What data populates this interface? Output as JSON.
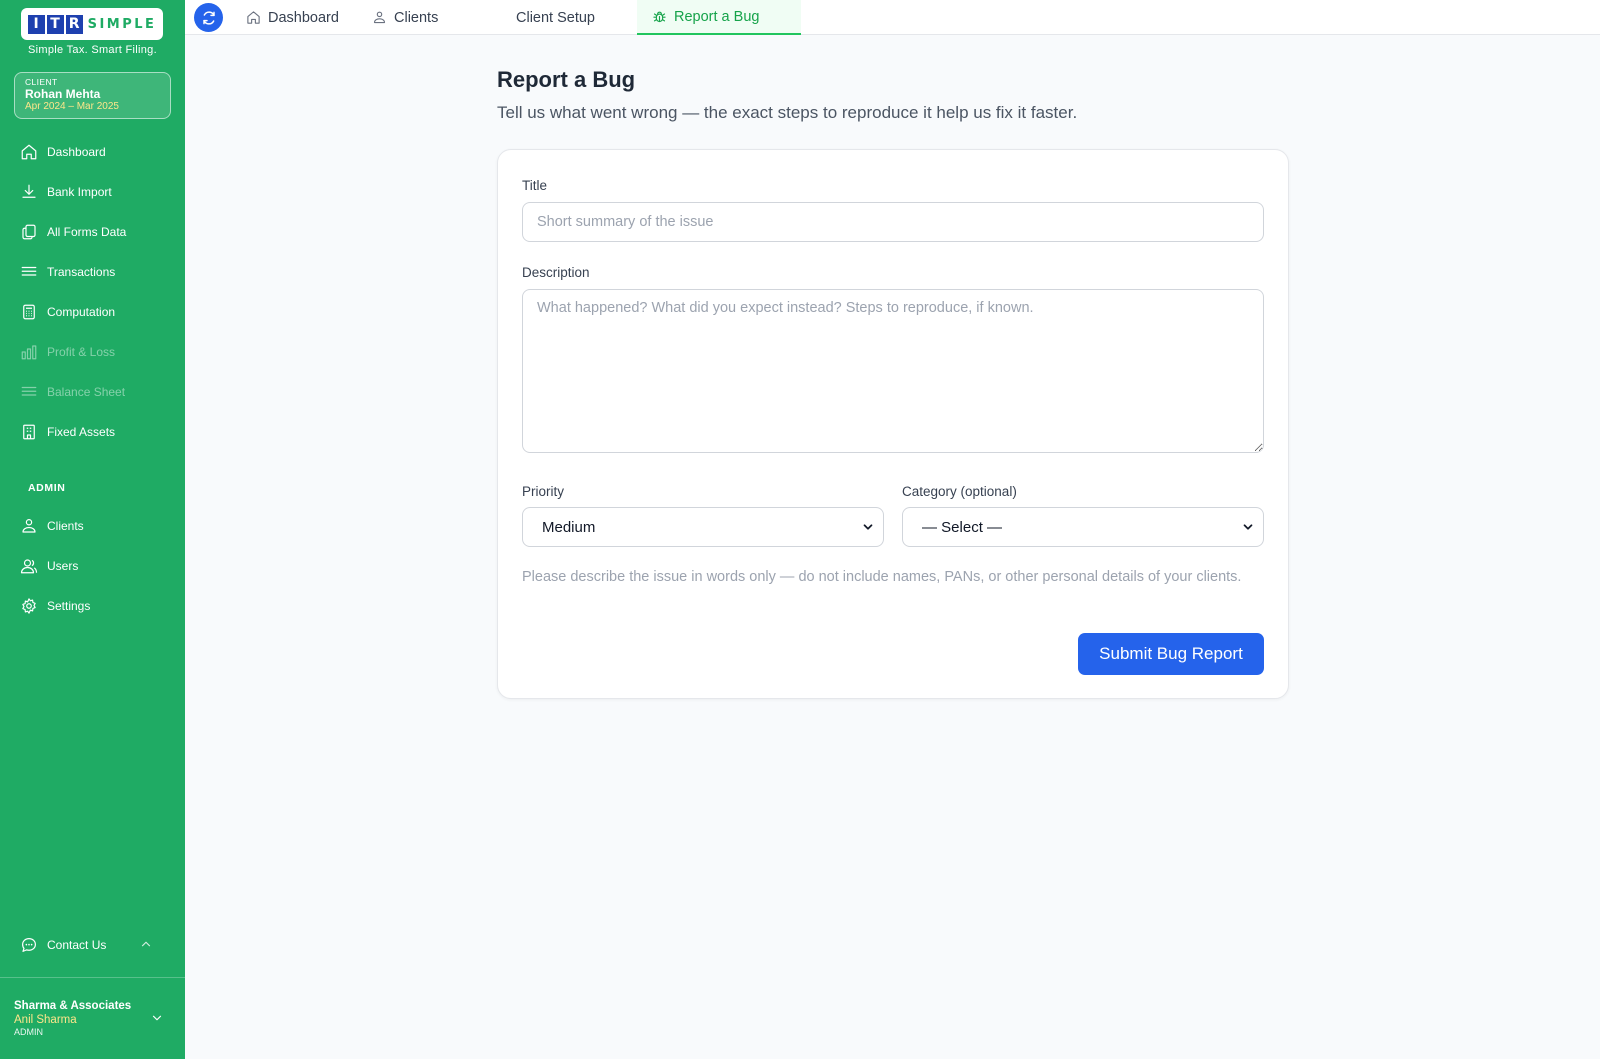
{
  "brand": {
    "logo_letters": [
      "I",
      "T",
      "R"
    ],
    "logo_rest": "SIMPLE",
    "tagline": "Simple Tax. Smart Filing.",
    "colors": {
      "sidebar": "#1fab64",
      "primary_button": "#2563eb",
      "active_tab": "#16a34a",
      "logo_blue": "#1e40af"
    }
  },
  "client_card": {
    "label": "CLIENT",
    "name": "Rohan Mehta",
    "period": "Apr 2024 – Mar 2025"
  },
  "sidebar": {
    "items": [
      {
        "label": "Dashboard",
        "icon": "home-icon",
        "enabled": true
      },
      {
        "label": "Bank Import",
        "icon": "download-icon",
        "enabled": true
      },
      {
        "label": "All Forms Data",
        "icon": "documents-icon",
        "enabled": true
      },
      {
        "label": "Transactions",
        "icon": "list-icon",
        "enabled": true
      },
      {
        "label": "Computation",
        "icon": "calculator-icon",
        "enabled": true
      },
      {
        "label": "Profit & Loss",
        "icon": "bar-chart-icon",
        "enabled": false
      },
      {
        "label": "Balance Sheet",
        "icon": "list-icon",
        "enabled": false
      },
      {
        "label": "Fixed Assets",
        "icon": "building-icon",
        "enabled": true
      }
    ],
    "admin_label": "ADMIN",
    "admin_items": [
      {
        "label": "Clients",
        "icon": "clients-icon"
      },
      {
        "label": "Users",
        "icon": "users-icon"
      },
      {
        "label": "Settings",
        "icon": "gear-icon"
      }
    ],
    "contact_label": "Contact Us",
    "firm": {
      "name": "Sharma & Associates",
      "user": "Anil Sharma",
      "role": "ADMIN"
    }
  },
  "topbar": {
    "tabs": [
      {
        "label": "Dashboard",
        "icon": "home-icon",
        "active": false
      },
      {
        "label": "Clients",
        "icon": "clients-icon",
        "active": false
      },
      {
        "label": "Client Setup",
        "icon": "",
        "active": false
      },
      {
        "label": "Report a Bug",
        "icon": "bug-icon",
        "active": true
      }
    ]
  },
  "page": {
    "title": "Report a Bug",
    "subtitle": "Tell us what went wrong — the exact steps to reproduce it help us fix it faster."
  },
  "form": {
    "title_label": "Title",
    "title_placeholder": "Short summary of the issue",
    "title_value": "",
    "description_label": "Description",
    "description_placeholder": "What happened? What did you expect instead? Steps to reproduce, if known.",
    "description_value": "",
    "priority_label": "Priority",
    "priority_value": "Medium",
    "category_label": "Category (optional)",
    "category_value": "— Select —",
    "note": "Please describe the issue in words only — do not include names, PANs, or other personal details of your clients.",
    "submit_label": "Submit Bug Report"
  }
}
